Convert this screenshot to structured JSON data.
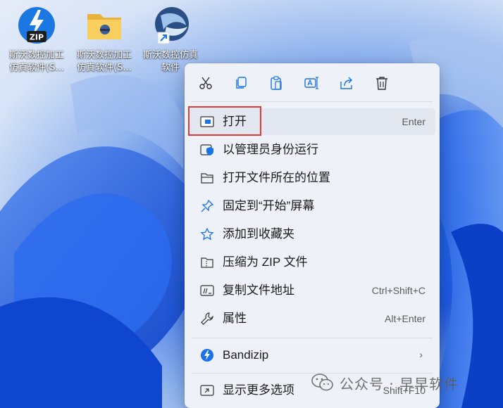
{
  "desktop": {
    "icons": [
      {
        "caption": "斯沃数控加工\n仿真软件(S...",
        "badge": "ZIP",
        "kind": "zip"
      },
      {
        "caption": "斯沃数控加工\n仿真软件(S...",
        "kind": "folder"
      },
      {
        "caption": "斯沃数控仿真\n软件",
        "kind": "shortcut"
      }
    ]
  },
  "menu": {
    "toolbar": [
      {
        "name": "cut-icon"
      },
      {
        "name": "copy-icon"
      },
      {
        "name": "paste-icon"
      },
      {
        "name": "rename-icon"
      },
      {
        "name": "share-icon"
      },
      {
        "name": "delete-icon"
      }
    ],
    "items": [
      {
        "label": "打开",
        "shortcut": "Enter",
        "icon": "open-window-icon",
        "selected": true
      },
      {
        "label": "以管理员身份运行",
        "shortcut": "",
        "icon": "shield-run-icon"
      },
      {
        "label": "打开文件所在的位置",
        "shortcut": "",
        "icon": "folder-open-icon"
      },
      {
        "label": "固定到“开始”屏幕",
        "shortcut": "",
        "icon": "pin-icon"
      },
      {
        "label": "添加到收藏夹",
        "shortcut": "",
        "icon": "star-icon"
      },
      {
        "label": "压缩为 ZIP 文件",
        "shortcut": "",
        "icon": "zip-folder-icon"
      },
      {
        "label": "复制文件地址",
        "shortcut": "Ctrl+Shift+C",
        "icon": "copy-path-icon"
      },
      {
        "label": "属性",
        "shortcut": "Alt+Enter",
        "icon": "wrench-icon"
      },
      {
        "label": "Bandizip",
        "shortcut": "",
        "icon": "bandizip-icon",
        "submenu": true
      },
      {
        "label": "显示更多选项",
        "shortcut": "Shift+F10",
        "icon": "more-options-icon"
      }
    ]
  },
  "watermark": {
    "text": "公众号 · 早早软件"
  },
  "colors": {
    "accent": "#1a73e8",
    "highlight_box": "#e53935",
    "menu_bg": "#eef1f7"
  }
}
